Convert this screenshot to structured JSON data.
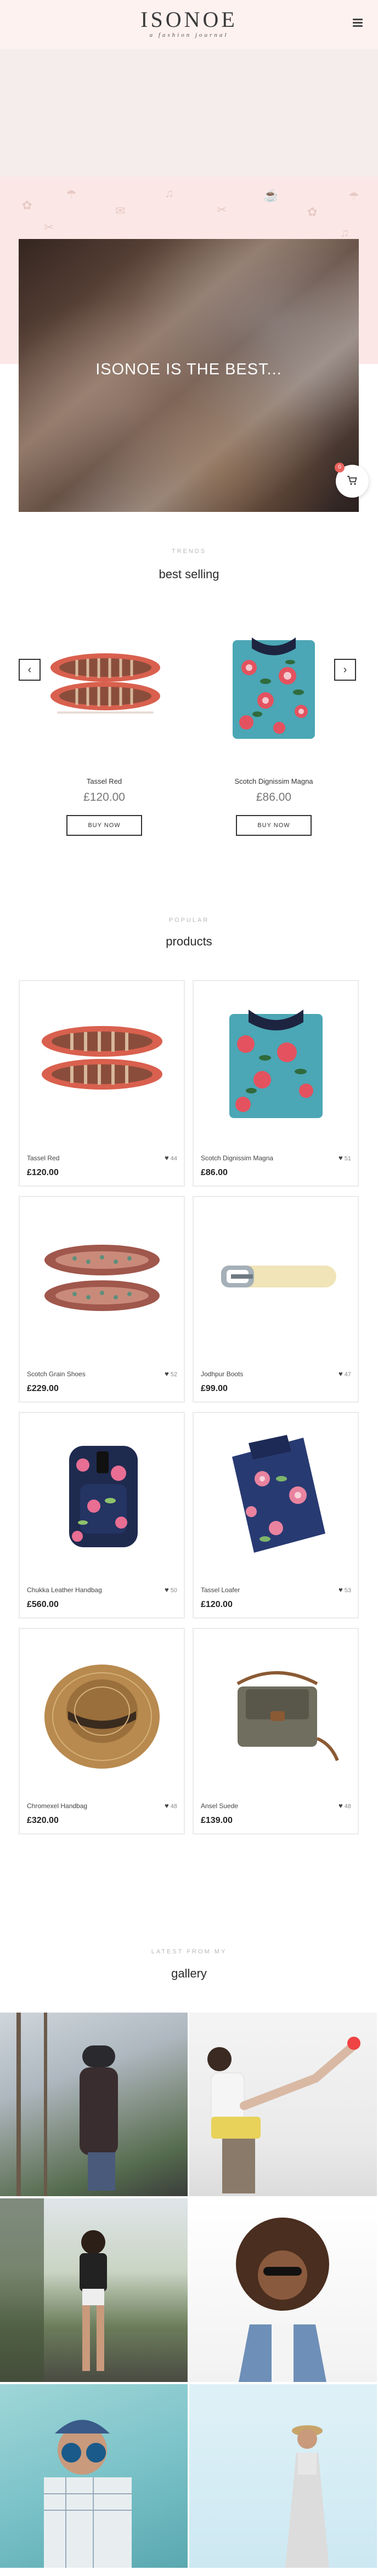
{
  "header": {
    "logo_title": "ISONOE",
    "logo_subtitle": "a fashion journal",
    "menu_icon": "hamburger-icon"
  },
  "hero": {
    "headline": "ISONOE IS THE BEST...",
    "cart_count": "0",
    "cart_icon": "cart-icon"
  },
  "best_selling": {
    "eyebrow": "TRENDS",
    "title": "best selling",
    "prev_icon": "chevron-left-icon",
    "next_icon": "chevron-right-icon",
    "items": [
      {
        "name": "Tassel Red",
        "price": "£120.00",
        "button": "BUY NOW"
      },
      {
        "name": "Scotch Dignissim Magna",
        "price": "£86.00",
        "button": "BUY NOW"
      }
    ]
  },
  "products": {
    "eyebrow": "POPULAR",
    "title": "products",
    "items": [
      {
        "name": "Tassel Red",
        "likes": "44",
        "price": "£120.00"
      },
      {
        "name": "Scotch Dignissim Magna",
        "likes": "51",
        "price": "£86.00"
      },
      {
        "name": "Scotch Grain Shoes",
        "likes": "52",
        "price": "£229.00"
      },
      {
        "name": "Jodhpur Boots",
        "likes": "47",
        "price": "£99.00"
      },
      {
        "name": "Chukka Leather Handbag",
        "likes": "50",
        "price": "£560.00"
      },
      {
        "name": "Tassel Loafer",
        "likes": "53",
        "price": "£120.00"
      },
      {
        "name": "Chromexel Handbag",
        "likes": "48",
        "price": "£320.00"
      },
      {
        "name": "Ansel Suede",
        "likes": "48",
        "price": "£139.00"
      }
    ]
  },
  "gallery": {
    "eyebrow": "LATEST FROM MY",
    "title": "gallery"
  },
  "colors": {
    "header_bg": "#fdf2f0",
    "hero_pink": "#fbe8e6",
    "badge_red": "#e9625c"
  }
}
